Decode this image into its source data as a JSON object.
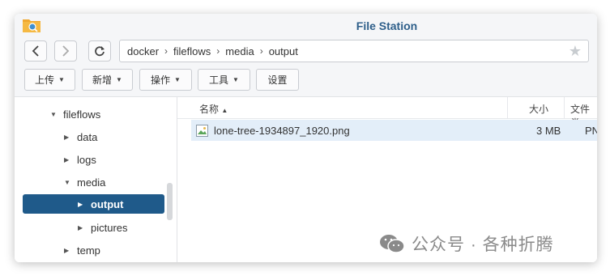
{
  "window": {
    "title": "File Station"
  },
  "toolbar": {
    "back_icon": "chevron-left-icon",
    "forward_icon": "chevron-right-icon",
    "refresh_icon": "refresh-icon",
    "breadcrumb": [
      "docker",
      "fileflows",
      "media",
      "output"
    ],
    "favorite_icon": "star-icon"
  },
  "actions": {
    "upload": "上传",
    "create": "新增",
    "operate": "操作",
    "tools": "工具",
    "settings": "设置"
  },
  "tree": {
    "items": [
      {
        "label": "fileflows",
        "state": "expanded"
      },
      {
        "label": "data",
        "state": "collapsed"
      },
      {
        "label": "logs",
        "state": "collapsed"
      },
      {
        "label": "media",
        "state": "expanded"
      },
      {
        "label": "output",
        "state": "collapsed",
        "selected": true
      },
      {
        "label": "pictures",
        "state": "collapsed"
      },
      {
        "label": "temp",
        "state": "collapsed"
      }
    ]
  },
  "filelist": {
    "columns": {
      "name": "名称",
      "name_sort": "▲",
      "size": "大小",
      "type": "文件类"
    },
    "rows": [
      {
        "name": "lone-tree-1934897_1920.png",
        "size": "3 MB",
        "type": "PNG",
        "icon": "image-file-icon"
      }
    ]
  },
  "watermark": {
    "text": "公众号 · 各种折腾",
    "icon": "wechat-icon"
  },
  "colors": {
    "accent": "#1f5a8a",
    "title": "#2e5f8a",
    "row_selected": "#e3eef9"
  }
}
